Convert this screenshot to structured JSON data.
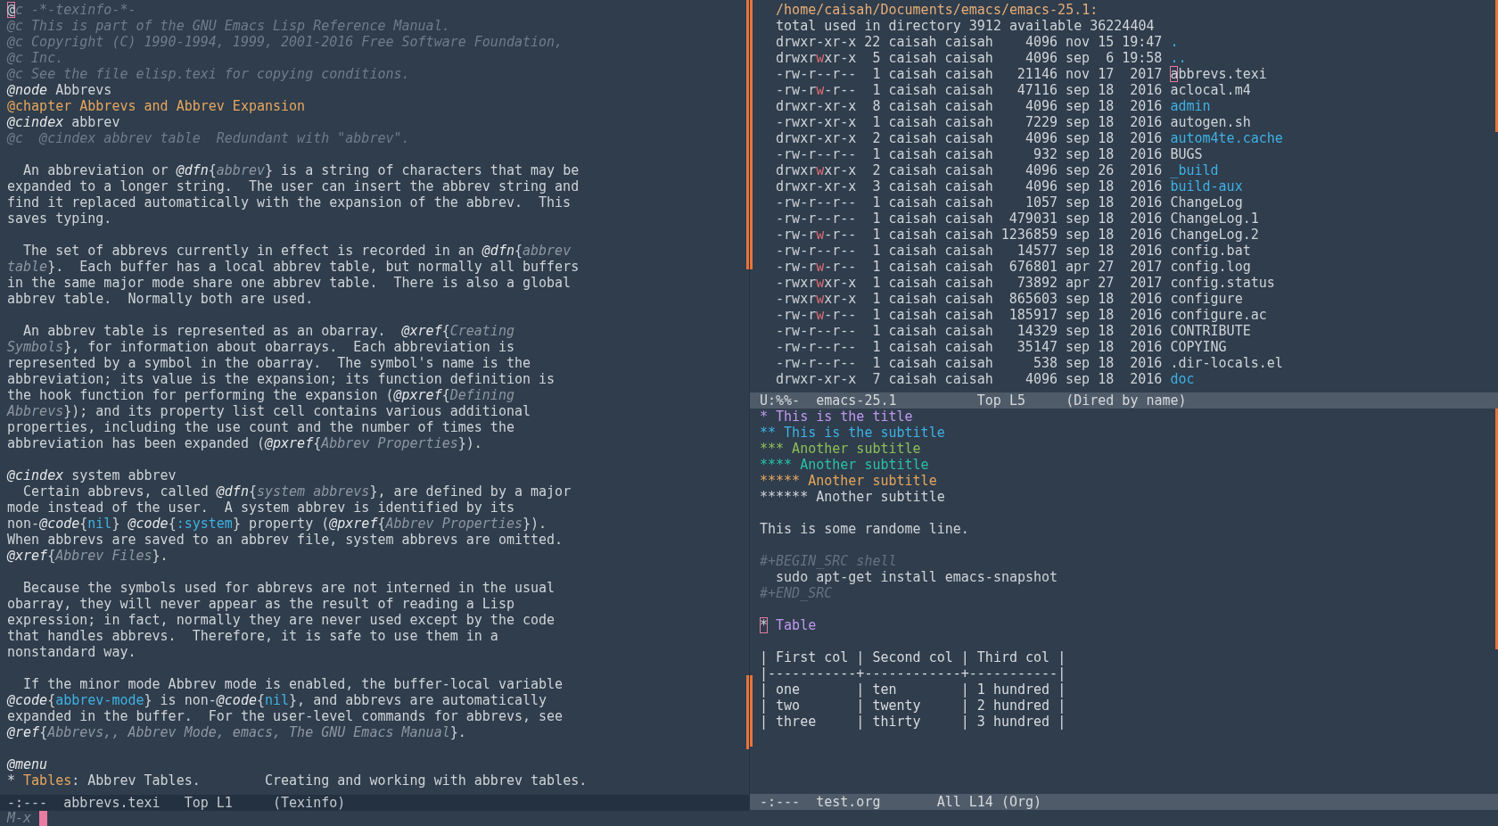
{
  "texinfo_buffer": {
    "lines": [
      {
        "kind": "text",
        "segments": [
          {
            "kind": "cursor",
            "text": "@"
          },
          {
            "kind": "comment",
            "text": "c -*-texinfo-*-"
          }
        ]
      },
      {
        "kind": "text",
        "segments": [
          {
            "kind": "comment",
            "text": "@c This is part of the GNU Emacs Lisp Reference Manual."
          }
        ]
      },
      {
        "kind": "text",
        "segments": [
          {
            "kind": "comment",
            "text": "@c Copyright (C) 1990-1994, 1999, 2001-2016 Free Software Foundation,"
          }
        ]
      },
      {
        "kind": "text",
        "segments": [
          {
            "kind": "comment",
            "text": "@c Inc."
          }
        ]
      },
      {
        "kind": "text",
        "segments": [
          {
            "kind": "comment",
            "text": "@c See the file elisp.texi for copying conditions."
          }
        ]
      },
      {
        "kind": "text",
        "segments": [
          {
            "kind": "command",
            "text": "@node"
          },
          {
            "kind": "plain",
            "text": " Abbrevs"
          }
        ]
      },
      {
        "kind": "text",
        "segments": [
          {
            "kind": "chapter",
            "text": "@chapter Abbrevs and Abbrev Expansion"
          }
        ]
      },
      {
        "kind": "text",
        "segments": [
          {
            "kind": "command",
            "text": "@cindex"
          },
          {
            "kind": "plain",
            "text": " abbrev"
          }
        ]
      },
      {
        "kind": "text",
        "segments": [
          {
            "kind": "comment",
            "text": "@c  @cindex abbrev table  Redundant with \"abbrev\"."
          }
        ]
      },
      {
        "kind": "blank"
      },
      {
        "kind": "text",
        "segments": [
          {
            "kind": "plain",
            "text": "  An abbreviation or "
          },
          {
            "kind": "command",
            "text": "@dfn"
          },
          {
            "kind": "plain",
            "text": "{"
          },
          {
            "kind": "arg",
            "text": "abbrev"
          },
          {
            "kind": "plain",
            "text": "} is a string of characters that may be"
          }
        ]
      },
      {
        "kind": "text",
        "segments": [
          {
            "kind": "plain",
            "text": "expanded to a longer string.  The user can insert the abbrev string and"
          }
        ]
      },
      {
        "kind": "text",
        "segments": [
          {
            "kind": "plain",
            "text": "find it replaced automatically with the expansion of the abbrev.  This"
          }
        ]
      },
      {
        "kind": "text",
        "segments": [
          {
            "kind": "plain",
            "text": "saves typing."
          }
        ]
      },
      {
        "kind": "blank"
      },
      {
        "kind": "text",
        "segments": [
          {
            "kind": "plain",
            "text": "  The set of abbrevs currently in effect is recorded in an "
          },
          {
            "kind": "command",
            "text": "@dfn"
          },
          {
            "kind": "plain",
            "text": "{"
          },
          {
            "kind": "arg",
            "text": "abbrev"
          }
        ]
      },
      {
        "kind": "text",
        "segments": [
          {
            "kind": "arg",
            "text": "table"
          },
          {
            "kind": "plain",
            "text": "}.  Each buffer has a local abbrev table, but normally all buffers"
          }
        ]
      },
      {
        "kind": "text",
        "segments": [
          {
            "kind": "plain",
            "text": "in the same major mode share one abbrev table.  There is also a global"
          }
        ]
      },
      {
        "kind": "text",
        "segments": [
          {
            "kind": "plain",
            "text": "abbrev table.  Normally both are used."
          }
        ]
      },
      {
        "kind": "blank"
      },
      {
        "kind": "text",
        "segments": [
          {
            "kind": "plain",
            "text": "  An abbrev table is represented as an obarray.  "
          },
          {
            "kind": "command",
            "text": "@xref"
          },
          {
            "kind": "plain",
            "text": "{"
          },
          {
            "kind": "arg",
            "text": "Creating"
          }
        ]
      },
      {
        "kind": "text",
        "segments": [
          {
            "kind": "arg",
            "text": "Symbols"
          },
          {
            "kind": "plain",
            "text": "}, for information about obarrays.  Each abbreviation is"
          }
        ]
      },
      {
        "kind": "text",
        "segments": [
          {
            "kind": "plain",
            "text": "represented by a symbol in the obarray.  The symbol's name is the"
          }
        ]
      },
      {
        "kind": "text",
        "segments": [
          {
            "kind": "plain",
            "text": "abbreviation; its value is the expansion; its function definition is"
          }
        ]
      },
      {
        "kind": "text",
        "segments": [
          {
            "kind": "plain",
            "text": "the hook function for performing the expansion ("
          },
          {
            "kind": "command",
            "text": "@pxref"
          },
          {
            "kind": "plain",
            "text": "{"
          },
          {
            "kind": "arg",
            "text": "Defining"
          }
        ]
      },
      {
        "kind": "text",
        "segments": [
          {
            "kind": "arg",
            "text": "Abbrevs"
          },
          {
            "kind": "plain",
            "text": "}); and its property list cell contains various additional"
          }
        ]
      },
      {
        "kind": "text",
        "segments": [
          {
            "kind": "plain",
            "text": "properties, including the use count and the number of times the"
          }
        ]
      },
      {
        "kind": "text",
        "segments": [
          {
            "kind": "plain",
            "text": "abbreviation has been expanded ("
          },
          {
            "kind": "command",
            "text": "@pxref"
          },
          {
            "kind": "plain",
            "text": "{"
          },
          {
            "kind": "arg",
            "text": "Abbrev Properties"
          },
          {
            "kind": "plain",
            "text": "})."
          }
        ]
      },
      {
        "kind": "blank"
      },
      {
        "kind": "text",
        "segments": [
          {
            "kind": "command",
            "text": "@cindex"
          },
          {
            "kind": "plain",
            "text": " system abbrev"
          }
        ]
      },
      {
        "kind": "text",
        "segments": [
          {
            "kind": "plain",
            "text": "  Certain abbrevs, called "
          },
          {
            "kind": "command",
            "text": "@dfn"
          },
          {
            "kind": "plain",
            "text": "{"
          },
          {
            "kind": "arg",
            "text": "system abbrevs"
          },
          {
            "kind": "plain",
            "text": "}, are defined by a major"
          }
        ]
      },
      {
        "kind": "text",
        "segments": [
          {
            "kind": "plain",
            "text": "mode instead of the user.  A system abbrev is identified by its"
          }
        ]
      },
      {
        "kind": "text",
        "segments": [
          {
            "kind": "plain",
            "text": "non-"
          },
          {
            "kind": "command",
            "text": "@code"
          },
          {
            "kind": "plain",
            "text": "{"
          },
          {
            "kind": "link",
            "text": "nil"
          },
          {
            "kind": "plain",
            "text": "} "
          },
          {
            "kind": "command",
            "text": "@code"
          },
          {
            "kind": "plain",
            "text": "{"
          },
          {
            "kind": "link",
            "text": ":system"
          },
          {
            "kind": "plain",
            "text": "} property ("
          },
          {
            "kind": "command",
            "text": "@pxref"
          },
          {
            "kind": "plain",
            "text": "{"
          },
          {
            "kind": "arg",
            "text": "Abbrev Properties"
          },
          {
            "kind": "plain",
            "text": "})."
          }
        ]
      },
      {
        "kind": "text",
        "segments": [
          {
            "kind": "plain",
            "text": "When abbrevs are saved to an abbrev file, system abbrevs are omitted."
          }
        ]
      },
      {
        "kind": "text",
        "segments": [
          {
            "kind": "command",
            "text": "@xref"
          },
          {
            "kind": "plain",
            "text": "{"
          },
          {
            "kind": "arg",
            "text": "Abbrev Files"
          },
          {
            "kind": "plain",
            "text": "}."
          }
        ]
      },
      {
        "kind": "blank"
      },
      {
        "kind": "text",
        "segments": [
          {
            "kind": "plain",
            "text": "  Because the symbols used for abbrevs are not interned in the usual"
          }
        ]
      },
      {
        "kind": "text",
        "segments": [
          {
            "kind": "plain",
            "text": "obarray, they will never appear as the result of reading a Lisp"
          }
        ]
      },
      {
        "kind": "text",
        "segments": [
          {
            "kind": "plain",
            "text": "expression; in fact, normally they are never used except by the code"
          }
        ]
      },
      {
        "kind": "text",
        "segments": [
          {
            "kind": "plain",
            "text": "that handles abbrevs.  Therefore, it is safe to use them in a"
          }
        ]
      },
      {
        "kind": "text",
        "segments": [
          {
            "kind": "plain",
            "text": "nonstandard way."
          }
        ]
      },
      {
        "kind": "blank"
      },
      {
        "kind": "text",
        "segments": [
          {
            "kind": "plain",
            "text": "  If the minor mode Abbrev mode is enabled, the buffer-local variable"
          }
        ]
      },
      {
        "kind": "text",
        "segments": [
          {
            "kind": "command",
            "text": "@code"
          },
          {
            "kind": "plain",
            "text": "{"
          },
          {
            "kind": "link",
            "text": "abbrev-mode"
          },
          {
            "kind": "plain",
            "text": "} is non-"
          },
          {
            "kind": "command",
            "text": "@code"
          },
          {
            "kind": "plain",
            "text": "{"
          },
          {
            "kind": "link",
            "text": "nil"
          },
          {
            "kind": "plain",
            "text": "}, and abbrevs are automatically"
          }
        ]
      },
      {
        "kind": "text",
        "segments": [
          {
            "kind": "plain",
            "text": "expanded in the buffer.  For the user-level commands for abbrevs, see"
          }
        ]
      },
      {
        "kind": "text",
        "segments": [
          {
            "kind": "command",
            "text": "@ref"
          },
          {
            "kind": "plain",
            "text": "{"
          },
          {
            "kind": "arg",
            "text": "Abbrevs,, Abbrev Mode, emacs, The GNU Emacs Manual"
          },
          {
            "kind": "plain",
            "text": "}."
          }
        ]
      },
      {
        "kind": "blank"
      },
      {
        "kind": "text",
        "segments": [
          {
            "kind": "command",
            "text": "@menu"
          }
        ]
      },
      {
        "kind": "text",
        "segments": [
          {
            "kind": "plain",
            "text": "* "
          },
          {
            "kind": "chapter",
            "text": "Tables"
          },
          {
            "kind": "plain",
            "text": ": Abbrev Tables.        Creating and working with abbrev tables."
          }
        ]
      }
    ]
  },
  "texinfo_mode_line": {
    "active": false,
    "status": "-:---",
    "buffer": "abbrevs.texi",
    "position": "Top L1",
    "mode": "(Texinfo)"
  },
  "dired_buffer": {
    "path": "/home/caisah/Documents/emacs/emacs-25.1:",
    "total": "total used in directory 3912 available 36224404",
    "entries": [
      {
        "kind": "dir",
        "mode": "drwxr-xr-x",
        "group_writable": false,
        "links": "22",
        "owner": "caisah",
        "group": "caisah",
        "size": "4096",
        "date": "nov 15 19:47",
        "name": ".",
        "cursor": false
      },
      {
        "kind": "dir",
        "mode": "drwxrwxr-x",
        "group_writable": true,
        "links": "5",
        "owner": "caisah",
        "group": "caisah",
        "size": "4096",
        "date": "sep  6 19:58",
        "name": "..",
        "cursor": false
      },
      {
        "kind": "file",
        "mode": "-rw-r--r--",
        "group_writable": false,
        "links": "1",
        "owner": "caisah",
        "group": "caisah",
        "size": "21146",
        "date": "nov 17  2017",
        "name": "abbrevs.texi",
        "cursor": true
      },
      {
        "kind": "file",
        "mode": "-rw-rw-r--",
        "group_writable": true,
        "links": "1",
        "owner": "caisah",
        "group": "caisah",
        "size": "47116",
        "date": "sep 18  2016",
        "name": "aclocal.m4",
        "cursor": false
      },
      {
        "kind": "dir",
        "mode": "drwxr-xr-x",
        "group_writable": false,
        "links": "8",
        "owner": "caisah",
        "group": "caisah",
        "size": "4096",
        "date": "sep 18  2016",
        "name": "admin",
        "cursor": false
      },
      {
        "kind": "file",
        "mode": "-rwxr-xr-x",
        "group_writable": false,
        "links": "1",
        "owner": "caisah",
        "group": "caisah",
        "size": "7229",
        "date": "sep 18  2016",
        "name": "autogen.sh",
        "cursor": false
      },
      {
        "kind": "dir",
        "mode": "drwxr-xr-x",
        "group_writable": false,
        "links": "2",
        "owner": "caisah",
        "group": "caisah",
        "size": "4096",
        "date": "sep 18  2016",
        "name": "autom4te.cache",
        "cursor": false
      },
      {
        "kind": "file",
        "mode": "-rw-r--r--",
        "group_writable": false,
        "links": "1",
        "owner": "caisah",
        "group": "caisah",
        "size": "932",
        "date": "sep 18  2016",
        "name": "BUGS",
        "cursor": false
      },
      {
        "kind": "dir",
        "mode": "drwxrwxr-x",
        "group_writable": true,
        "links": "2",
        "owner": "caisah",
        "group": "caisah",
        "size": "4096",
        "date": "sep 26  2016",
        "name": "_build",
        "cursor": false
      },
      {
        "kind": "dir",
        "mode": "drwxr-xr-x",
        "group_writable": false,
        "links": "3",
        "owner": "caisah",
        "group": "caisah",
        "size": "4096",
        "date": "sep 18  2016",
        "name": "build-aux",
        "cursor": false
      },
      {
        "kind": "file",
        "mode": "-rw-r--r--",
        "group_writable": false,
        "links": "1",
        "owner": "caisah",
        "group": "caisah",
        "size": "1057",
        "date": "sep 18  2016",
        "name": "ChangeLog",
        "cursor": false
      },
      {
        "kind": "file",
        "mode": "-rw-r--r--",
        "group_writable": false,
        "links": "1",
        "owner": "caisah",
        "group": "caisah",
        "size": "479031",
        "date": "sep 18  2016",
        "name": "ChangeLog.1",
        "cursor": false
      },
      {
        "kind": "file",
        "mode": "-rw-rw-r--",
        "group_writable": true,
        "links": "1",
        "owner": "caisah",
        "group": "caisah",
        "size": "1236859",
        "date": "sep 18  2016",
        "name": "ChangeLog.2",
        "cursor": false
      },
      {
        "kind": "file",
        "mode": "-rw-r--r--",
        "group_writable": false,
        "links": "1",
        "owner": "caisah",
        "group": "caisah",
        "size": "14577",
        "date": "sep 18  2016",
        "name": "config.bat",
        "cursor": false
      },
      {
        "kind": "file",
        "mode": "-rw-rw-r--",
        "group_writable": true,
        "links": "1",
        "owner": "caisah",
        "group": "caisah",
        "size": "676801",
        "date": "apr 27  2017",
        "name": "config.log",
        "cursor": false
      },
      {
        "kind": "file",
        "mode": "-rwxrwxr-x",
        "group_writable": true,
        "links": "1",
        "owner": "caisah",
        "group": "caisah",
        "size": "73892",
        "date": "apr 27  2017",
        "name": "config.status",
        "cursor": false
      },
      {
        "kind": "file",
        "mode": "-rwxrwxr-x",
        "group_writable": true,
        "links": "1",
        "owner": "caisah",
        "group": "caisah",
        "size": "865603",
        "date": "sep 18  2016",
        "name": "configure",
        "cursor": false
      },
      {
        "kind": "file",
        "mode": "-rw-rw-r--",
        "group_writable": true,
        "links": "1",
        "owner": "caisah",
        "group": "caisah",
        "size": "185917",
        "date": "sep 18  2016",
        "name": "configure.ac",
        "cursor": false
      },
      {
        "kind": "file",
        "mode": "-rw-r--r--",
        "group_writable": false,
        "links": "1",
        "owner": "caisah",
        "group": "caisah",
        "size": "14329",
        "date": "sep 18  2016",
        "name": "CONTRIBUTE",
        "cursor": false
      },
      {
        "kind": "file",
        "mode": "-rw-r--r--",
        "group_writable": false,
        "links": "1",
        "owner": "caisah",
        "group": "caisah",
        "size": "35147",
        "date": "sep 18  2016",
        "name": "COPYING",
        "cursor": false
      },
      {
        "kind": "file",
        "mode": "-rw-r--r--",
        "group_writable": false,
        "links": "1",
        "owner": "caisah",
        "group": "caisah",
        "size": "538",
        "date": "sep 18  2016",
        "name": ".dir-locals.el",
        "cursor": false
      },
      {
        "kind": "dir",
        "mode": "drwxr-xr-x",
        "group_writable": false,
        "links": "7",
        "owner": "caisah",
        "group": "caisah",
        "size": "4096",
        "date": "sep 18  2016",
        "name": "doc",
        "cursor": false
      }
    ]
  },
  "dired_mode_line": {
    "active": true,
    "status": "U:%%-",
    "buffer": "emacs-25.1",
    "position": "Top L5",
    "mode": "(Dired by name)"
  },
  "org_buffer": {
    "lines": [
      {
        "kind": "text",
        "segments": [
          {
            "kind": "org1",
            "text": "* This is the title"
          }
        ]
      },
      {
        "kind": "text",
        "segments": [
          {
            "kind": "org2",
            "text": "** This is the subtitle"
          }
        ]
      },
      {
        "kind": "text",
        "segments": [
          {
            "kind": "org3",
            "text": "*** Another subtitle"
          }
        ]
      },
      {
        "kind": "text",
        "segments": [
          {
            "kind": "org4",
            "text": "**** Another subtitle"
          }
        ]
      },
      {
        "kind": "text",
        "segments": [
          {
            "kind": "org5",
            "text": "***** Another subtitle"
          }
        ]
      },
      {
        "kind": "text",
        "segments": [
          {
            "kind": "org6",
            "text": "****** Another subtitle"
          }
        ]
      },
      {
        "kind": "blank"
      },
      {
        "kind": "text",
        "segments": [
          {
            "kind": "plain",
            "text": "This is some randome line."
          }
        ]
      },
      {
        "kind": "blank"
      },
      {
        "kind": "text",
        "segments": [
          {
            "kind": "meta",
            "text": "#+BEGIN_SRC shell"
          }
        ]
      },
      {
        "kind": "text",
        "segments": [
          {
            "kind": "plain",
            "text": "  sudo apt-get install emacs-snapshot"
          }
        ]
      },
      {
        "kind": "text",
        "segments": [
          {
            "kind": "meta",
            "text": "#+END_SRC"
          }
        ]
      },
      {
        "kind": "blank"
      },
      {
        "kind": "text",
        "segments": [
          {
            "kind": "cursor",
            "text": "*"
          },
          {
            "kind": "org1",
            "text": " Table"
          }
        ]
      },
      {
        "kind": "blank"
      },
      {
        "kind": "text",
        "segments": [
          {
            "kind": "table",
            "text": "| First col | Second col | Third col |"
          }
        ]
      },
      {
        "kind": "text",
        "segments": [
          {
            "kind": "table",
            "text": "|-----------+------------+-----------|"
          }
        ]
      },
      {
        "kind": "text",
        "segments": [
          {
            "kind": "table",
            "text": "| one       | ten        | 1 hundred |"
          }
        ]
      },
      {
        "kind": "text",
        "segments": [
          {
            "kind": "table",
            "text": "| two       | twenty     | 2 hundred |"
          }
        ]
      },
      {
        "kind": "text",
        "segments": [
          {
            "kind": "table",
            "text": "| three     | thirty     | 3 hundred |"
          }
        ]
      }
    ]
  },
  "org_mode_line": {
    "active": true,
    "status": "-:---",
    "buffer": "test.org",
    "position": "All L14",
    "mode": "(Org)"
  },
  "minibuffer": {
    "prompt": "M-x"
  }
}
